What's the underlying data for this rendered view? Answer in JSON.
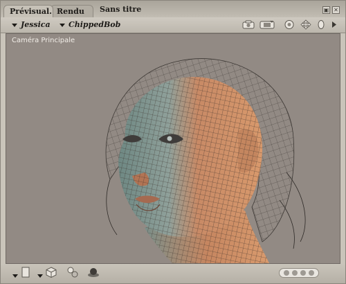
{
  "tabs": [
    {
      "label": "Prévisual.",
      "active": true
    },
    {
      "label": "Rendu",
      "active": false
    }
  ],
  "window": {
    "title": "Sans titre"
  },
  "toolbar": {
    "figure_select": "Jessica",
    "element_select": "ChippedBob"
  },
  "viewport": {
    "camera_label": "Caméra Principale",
    "background_color": "#928a84"
  },
  "bottombar": {
    "pager_dots": 4
  },
  "icons": [
    "window-resize-icon",
    "window-close-icon",
    "camera-icon",
    "render-icon",
    "trackball-icon",
    "move-icon",
    "scale-icon",
    "expand-arrow-icon",
    "dropdown-triangle-icon",
    "cube-icon",
    "lights-icon",
    "ground-icon"
  ]
}
